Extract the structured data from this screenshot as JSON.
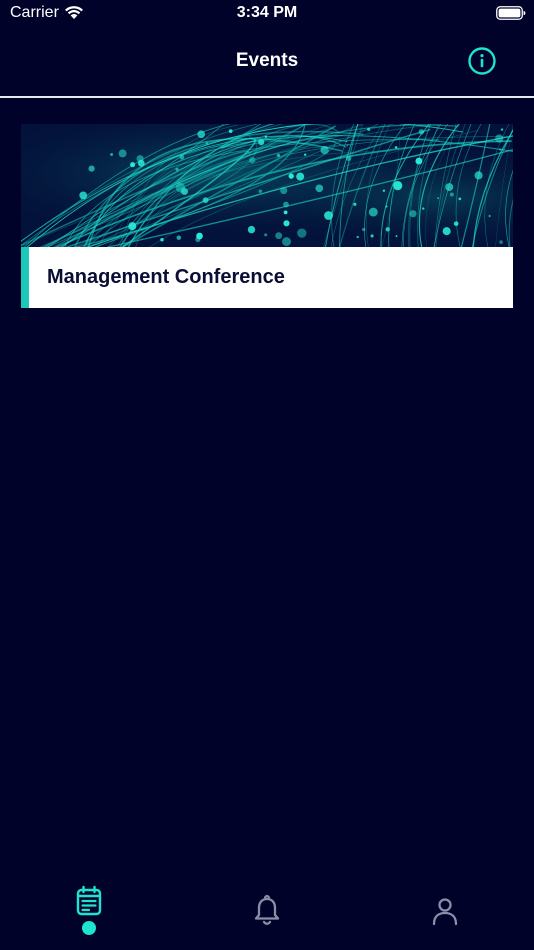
{
  "status_bar": {
    "carrier": "Carrier",
    "time": "3:34 PM",
    "icons": [
      "wifi-icon",
      "battery-icon"
    ]
  },
  "nav": {
    "title": "Events",
    "info_icon": "info-icon"
  },
  "events": [
    {
      "title": "Management Conference",
      "banner": "teal-light-streaks-banner"
    }
  ],
  "tab_bar": {
    "tabs": [
      {
        "icon": "calendar-icon",
        "selected": true
      },
      {
        "icon": "bell-icon",
        "selected": false
      },
      {
        "icon": "person-icon",
        "selected": false
      }
    ]
  },
  "colors": {
    "background": "#00022a",
    "accent": "#1de3cf",
    "card_text": "#0a0d35",
    "inactive_icon": "#8a8fa8"
  }
}
